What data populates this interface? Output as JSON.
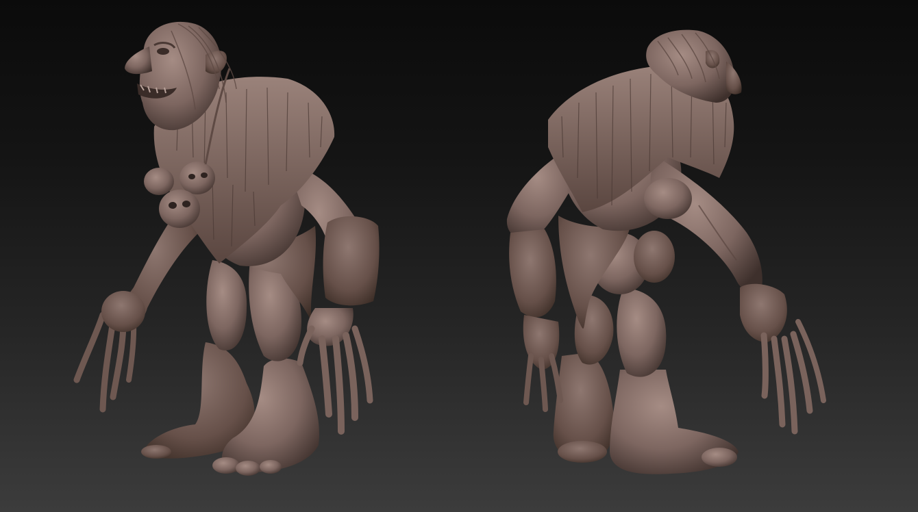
{
  "scene": {
    "background_top": "#0b0b0b",
    "background_bottom": "#3c3c3c",
    "clay_color": "#7d6660",
    "clay_highlight": "#a58c84",
    "clay_shadow": "#3e302c",
    "views": [
      {
        "name": "front-three-quarter-view"
      },
      {
        "name": "back-three-quarter-view"
      }
    ]
  }
}
